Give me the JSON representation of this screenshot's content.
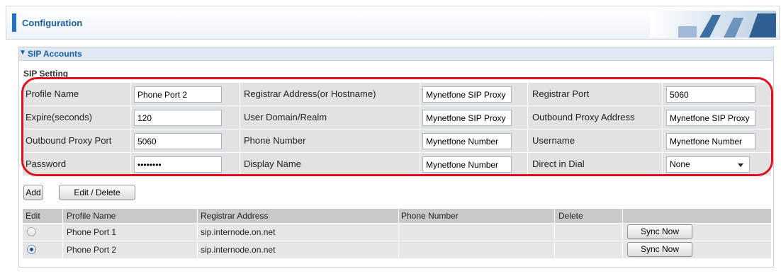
{
  "header": {
    "title": "Configuration"
  },
  "section": {
    "title": "SIP Accounts",
    "subtitle": "SIP Setting"
  },
  "settings": {
    "profile_name": {
      "label": "Profile Name",
      "value": "Phone Port 2"
    },
    "registrar_address": {
      "label": "Registrar Address(or Hostname)",
      "value": "Mynetfone SIP Proxy"
    },
    "registrar_port": {
      "label": "Registrar Port",
      "value": "5060"
    },
    "expire": {
      "label": "Expire(seconds)",
      "value": "120"
    },
    "user_domain": {
      "label": "User Domain/Realm",
      "value": "Mynetfone SIP Proxy"
    },
    "outbound_proxy_address": {
      "label": "Outbound Proxy Address",
      "value": "Mynetfone SIP Proxy"
    },
    "outbound_proxy_port": {
      "label": "Outbound Proxy Port",
      "value": "5060"
    },
    "phone_number": {
      "label": "Phone Number",
      "value": "Mynetfone Number"
    },
    "username": {
      "label": "Username",
      "value": "Mynetfone Number"
    },
    "password": {
      "label": "Password",
      "value": "password"
    },
    "display_name": {
      "label": "Display Name",
      "value": "Mynetfone Number"
    },
    "direct_in_dial": {
      "label": "Direct in Dial",
      "value": "None"
    }
  },
  "buttons": {
    "add": "Add",
    "edit_delete": "Edit / Delete",
    "sync_now": "Sync Now"
  },
  "table": {
    "headers": [
      "Edit",
      "Profile Name",
      "Registrar Address",
      "Phone Number",
      "Delete",
      ""
    ],
    "rows": [
      {
        "selected": false,
        "profile_name": "Phone Port 1",
        "registrar_address": "sip.internode.on.net",
        "phone_number": "",
        "delete": ""
      },
      {
        "selected": true,
        "profile_name": "Phone Port 2",
        "registrar_address": "sip.internode.on.net",
        "phone_number": "",
        "delete": ""
      }
    ]
  },
  "colors": {
    "accent": "#1d73c9",
    "highlight": "#e0101d",
    "row_bg": "#e2e2e2"
  }
}
